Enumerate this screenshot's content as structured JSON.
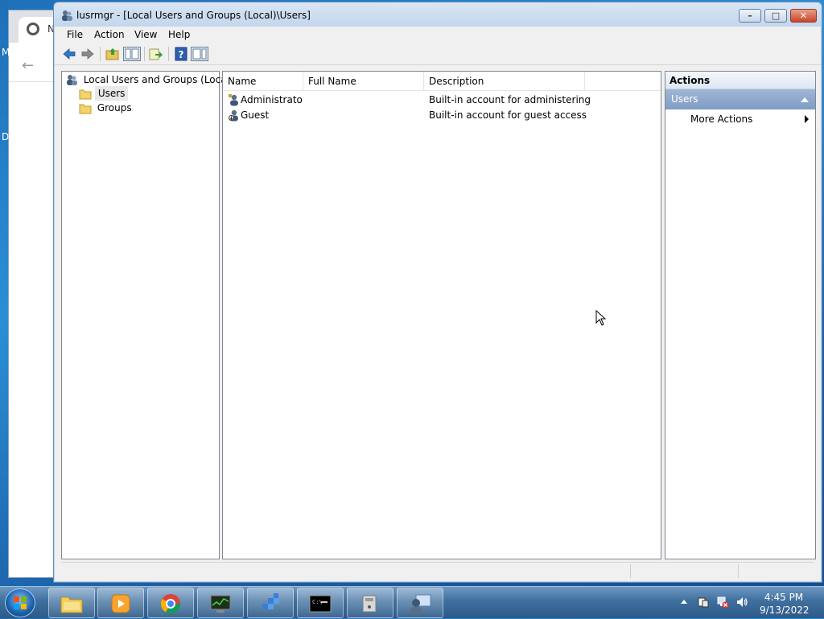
{
  "background": {
    "browser_tab_title": "N",
    "desktop_labels": [
      "M",
      "D"
    ]
  },
  "window": {
    "title": "lusrmgr - [Local Users and Groups (Local)\\Users]",
    "icon": "users-groups-icon",
    "controls": {
      "minimize": "minimize-icon",
      "maximize": "maximize-icon",
      "close": "close-icon"
    }
  },
  "menu": [
    "File",
    "Action",
    "View",
    "Help"
  ],
  "toolbar": [
    "back-icon",
    "forward-icon",
    "up-folder-icon",
    "show-hide-tree-icon",
    "export-list-icon",
    "help-icon",
    "show-hide-action-pane-icon"
  ],
  "tree": {
    "root": "Local Users and Groups (Local)",
    "children": [
      {
        "label": "Users",
        "selected": true
      },
      {
        "label": "Groups",
        "selected": false
      }
    ]
  },
  "list": {
    "columns": [
      "Name",
      "Full Name",
      "Description"
    ],
    "rows": [
      {
        "name": "Administrator",
        "full_name": "",
        "description": "Built-in account for administering..."
      },
      {
        "name": "Guest",
        "full_name": "",
        "description": "Built-in account for guest access t..."
      }
    ]
  },
  "actions": {
    "title": "Actions",
    "section": "Users",
    "items": [
      "More Actions"
    ]
  },
  "taskbar": {
    "apps": [
      "file-explorer-icon",
      "media-player-icon",
      "chrome-icon",
      "task-manager-icon",
      "registry-editor-icon",
      "command-prompt-icon",
      "system-drive-icon",
      "users-management-icon"
    ],
    "clock_time": "4:45 PM",
    "clock_date": "9/13/2022"
  },
  "colors": {
    "accent": "#7f9cc4",
    "titlebar": "#c3d6ec",
    "taskbar": "#3f6f9e"
  }
}
